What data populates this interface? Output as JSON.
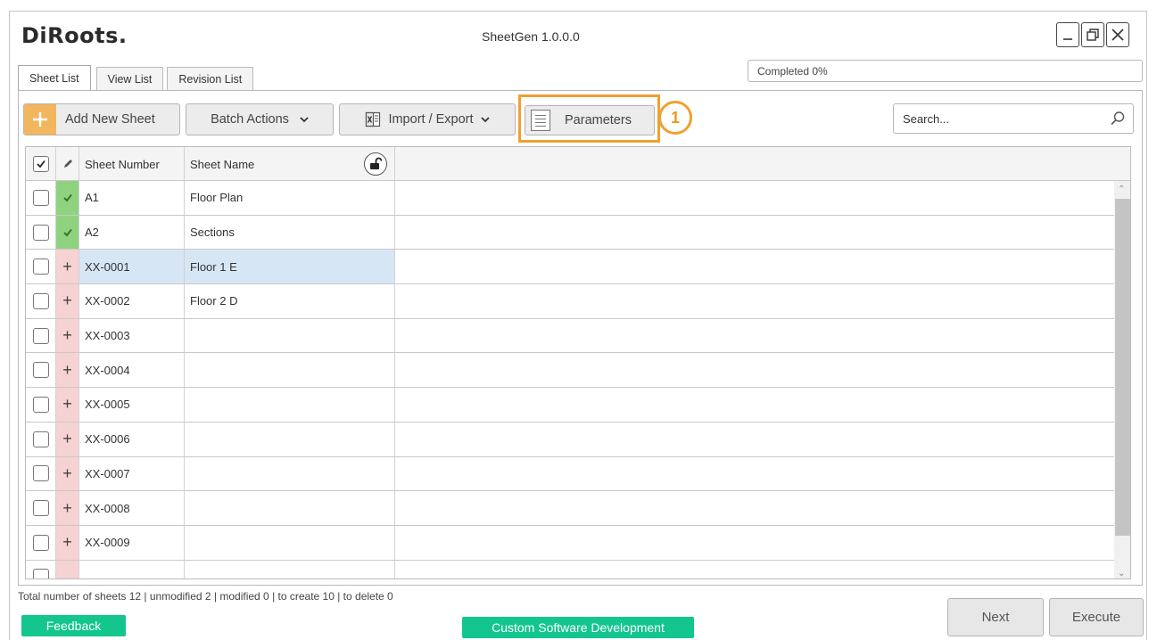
{
  "app": {
    "logo": "DiRoots.",
    "title": "SheetGen 1.0.0.0"
  },
  "tabs": [
    {
      "label": "Sheet List"
    },
    {
      "label": "View List"
    },
    {
      "label": "Revision List"
    }
  ],
  "progress_text": "Completed 0%",
  "toolbar": {
    "add_label": "Add New Sheet",
    "batch_label": "Batch Actions",
    "import_label": "Import / Export",
    "params_label": "Parameters",
    "badge": "1",
    "search_placeholder": "Search..."
  },
  "table": {
    "columns": [
      "Sheet Number",
      "Sheet Name"
    ],
    "rows": [
      {
        "number": "A1",
        "name": "Floor Plan"
      },
      {
        "number": "A2",
        "name": "Sections"
      },
      {
        "number": "XX-0001",
        "name": "Floor 1 E"
      },
      {
        "number": "XX-0002",
        "name": "Floor 2 D"
      },
      {
        "number": "XX-0003",
        "name": ""
      },
      {
        "number": "XX-0004",
        "name": ""
      },
      {
        "number": "XX-0005",
        "name": ""
      },
      {
        "number": "XX-0006",
        "name": ""
      },
      {
        "number": "XX-0007",
        "name": ""
      },
      {
        "number": "XX-0008",
        "name": ""
      },
      {
        "number": "XX-0009",
        "name": ""
      }
    ]
  },
  "status_text": "Total number of sheets 12 | unmodified 2 | modified 0 | to create 10 | to delete 0",
  "footer": {
    "feedback": "Feedback",
    "custom": "Custom Software Development",
    "next": "Next",
    "execute": "Execute"
  }
}
